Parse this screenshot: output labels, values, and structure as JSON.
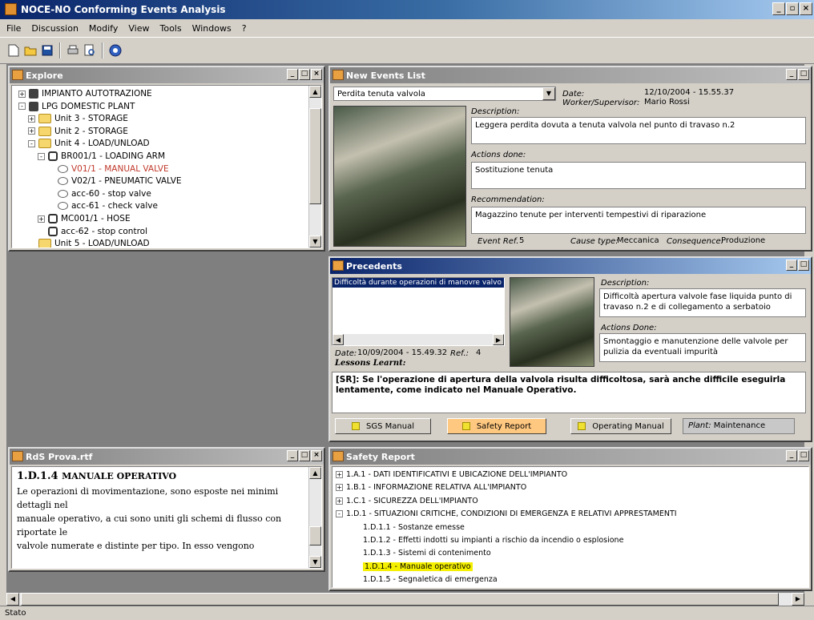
{
  "app": {
    "title": "NOCE-NO Conforming Events Analysis"
  },
  "menu": [
    "File",
    "Discussion",
    "Modify",
    "View",
    "Tools",
    "Windows",
    "?"
  ],
  "toolbar_icons": [
    "new-document-icon",
    "open-folder-icon",
    "save-icon",
    "print-icon",
    "print-preview-icon",
    "help-icon"
  ],
  "explore": {
    "title": "Explore",
    "items": [
      {
        "label": "IMPIANTO AUTOTRAZIONE",
        "level": 0,
        "exp": "+",
        "icon": "plant-icon"
      },
      {
        "label": "LPG DOMESTIC PLANT",
        "level": 0,
        "exp": "-",
        "icon": "plant-icon"
      },
      {
        "label": "Unit 3 - STORAGE",
        "level": 1,
        "exp": "+",
        "icon": "folder-icon"
      },
      {
        "label": "Unit 2 - STORAGE",
        "level": 1,
        "exp": "+",
        "icon": "folder-icon"
      },
      {
        "label": "Unit 4 - LOAD/UNLOAD",
        "level": 1,
        "exp": "-",
        "icon": "folder-icon"
      },
      {
        "label": "BR001/1 - LOADING ARM",
        "level": 2,
        "exp": "-",
        "icon": "component-icon"
      },
      {
        "label": "V01/1 - MANUAL VALVE",
        "level": 3,
        "exp": "",
        "icon": "valve-icon",
        "selected": true
      },
      {
        "label": "V02/1 - PNEUMATIC VALVE",
        "level": 3,
        "exp": "",
        "icon": "valve-icon"
      },
      {
        "label": "acc-60 - stop valve",
        "level": 3,
        "exp": "",
        "icon": "valve-icon"
      },
      {
        "label": "acc-61 - check valve",
        "level": 3,
        "exp": "",
        "icon": "valve-icon"
      },
      {
        "label": "MC001/1 - HOSE",
        "level": 2,
        "exp": "+",
        "icon": "component-icon"
      },
      {
        "label": "acc-62 - stop control",
        "level": 2,
        "exp": "",
        "icon": "component-icon"
      },
      {
        "label": "Unit 5 - LOAD/UNLOAD",
        "level": 1,
        "exp": "",
        "icon": "folder-icon"
      }
    ]
  },
  "new_events": {
    "title": "New Events List",
    "selected_event": "Perdita tenuta valvola",
    "date_label": "Date:",
    "date_value": "12/10/2004 - 15.55.37",
    "worker_label": "Worker/Supervisor:",
    "worker_value": "Mario Rossi",
    "description_label": "Description:",
    "description": "Leggera perdita dovuta a tenuta valvola nel punto di travaso n.2",
    "actions_label": "Actions done:",
    "actions": "Sostituzione tenuta",
    "recommendation_label": "Recommendation:",
    "recommendation": "Magazzino tenute per interventi tempestivi di riparazione",
    "event_ref_label": "Event Ref.",
    "event_ref": "5",
    "cause_label": "Cause type:",
    "cause": "Meccanica",
    "consequence_label": "Consequence:",
    "consequence": "Produzione"
  },
  "precedents": {
    "title": "Precedents",
    "list_item": "Difficoltà durante operazioni di manovre valvo",
    "date_label": "Date:",
    "date_value": "10/09/2004 - 15.49.32",
    "ref_label": "Ref.:",
    "ref_value": "4",
    "lessons_label": "Lessons Learnt:",
    "lessons": "[SR]: Se l'operazione di apertura della valvola risulta difficoltosa, sarà anche difficile eseguirla lentamente, come indicato nel Manuale Operativo.",
    "description_label": "Description:",
    "description": "Difficoltà apertura valvole fase liquida punto di travaso n.2 e di collegamento a serbatoio",
    "actions_label": "Actions Done:",
    "actions": "Smontaggio e manutenzione delle valvole per pulizia da eventuali impurità",
    "buttons": {
      "sgs": "SGS Manual",
      "safety": "Safety Report",
      "operating": "Operating Manual"
    },
    "plant_label": "Plant:",
    "plant_value": "Maintenance"
  },
  "rds": {
    "title": "RdS Prova.rtf",
    "heading_num": "1.D.1.4",
    "heading_text": "MANUALE OPERATIVO",
    "lines": [
      "Le operazioni di movimentazione, sono esposte nei minimi",
      "dettagli nel",
      "manuale operativo, a cui sono uniti gli schemi di flusso con",
      "riportate le",
      "valvole numerate e distinte per tipo. In esso vengono"
    ]
  },
  "safety_report": {
    "title": "Safety Report",
    "items": [
      {
        "label": "1.A.1 - DATI IDENTIFICATIVI E UBICAZIONE DELL'IMPIANTO",
        "level": 0,
        "exp": "+"
      },
      {
        "label": "1.B.1 - INFORMAZIONE RELATIVA ALL'IMPIANTO",
        "level": 0,
        "exp": "+"
      },
      {
        "label": "1.C.1 - SICUREZZA DELL'IMPIANTO",
        "level": 0,
        "exp": "+"
      },
      {
        "label": "1.D.1 - SITUAZIONI CRITICHE, CONDIZIONI DI EMERGENZA E RELATIVI APPRESTAMENTI",
        "level": 0,
        "exp": "-"
      },
      {
        "label": "1.D.1.1 - Sostanze emesse",
        "level": 1,
        "exp": ""
      },
      {
        "label": "1.D.1.2 - Effetti indotti su impianti a rischio da incendio o esplosione",
        "level": 1,
        "exp": ""
      },
      {
        "label": "1.D.1.3 - Sistemi di contenimento",
        "level": 1,
        "exp": ""
      },
      {
        "label": "1.D.1.4 - Manuale operativo",
        "level": 1,
        "exp": "",
        "selected": true
      },
      {
        "label": "1.D.1.5 - Segnaletica di emergenza",
        "level": 1,
        "exp": ""
      }
    ]
  },
  "status": {
    "text": "Stato"
  },
  "colors": {
    "selected_tree": "#c0392b",
    "highlight": "#f5f000",
    "safety_btn": "#ffc880"
  }
}
